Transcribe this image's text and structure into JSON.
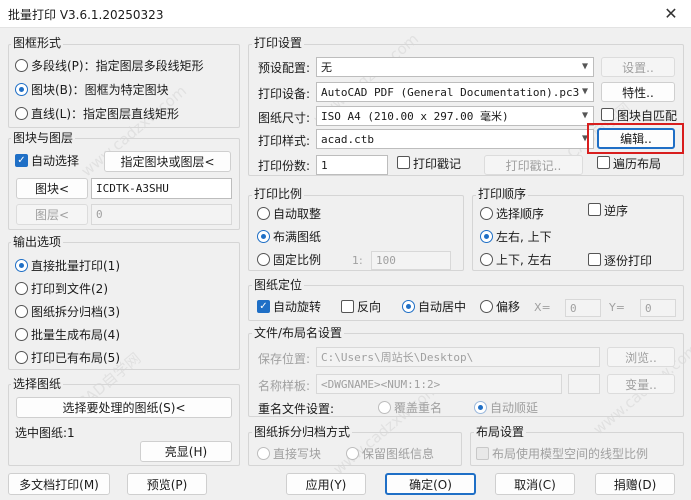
{
  "window": {
    "title": "批量打印 V3.6.1.20250323",
    "close_glyph": "✕"
  },
  "frame_style": {
    "label": "图框形式",
    "options": [
      {
        "label": "多段线(P)：指定图层多段线矩形",
        "selected": false
      },
      {
        "label": "图块(B)：图框为特定图块",
        "selected": true
      },
      {
        "label": "直线(L)：指定图层直线矩形",
        "selected": false
      }
    ]
  },
  "block_layer": {
    "label": "图块与图层",
    "auto_select_label": "自动选择",
    "auto_select_checked": true,
    "pick_button": "指定图块或图层<",
    "block_button": "图块<",
    "block_value": "ICDTK-A3SHU",
    "layer_button": "图层<",
    "layer_value": "0"
  },
  "output": {
    "label": "输出选项",
    "options": [
      {
        "label": "直接批量打印(1)",
        "selected": true
      },
      {
        "label": "打印到文件(2)",
        "selected": false
      },
      {
        "label": "图纸拆分归档(3)",
        "selected": false
      },
      {
        "label": "批量生成布局(4)",
        "selected": false
      },
      {
        "label": "打印已有布局(5)",
        "selected": false
      }
    ]
  },
  "select_drawing": {
    "label": "选择图纸",
    "select_button": "选择要处理的图纸(S)<",
    "selected_text": "选中图纸:1",
    "highlight_button": "亮显(H)"
  },
  "print_settings": {
    "label": "打印设置",
    "preset_label": "预设配置:",
    "preset_value": "无",
    "preset_settings_button": "设置..",
    "device_label": "打印设备:",
    "device_value": "AutoCAD PDF (General Documentation).pc3",
    "properties_button": "特性..",
    "paper_label": "图纸尺寸:",
    "paper_value": "ISO A4 (210.00 x 297.00 毫米)",
    "auto_match_label": "图块自匹配",
    "style_label": "打印样式:",
    "style_value": "acad.ctb",
    "edit_button": "编辑..",
    "copies_label": "打印份数:",
    "copies_value": "1",
    "stamp_label": "打印戳记",
    "stamp_button": "打印戳记..",
    "traverse_label": "遍历布局"
  },
  "print_scale": {
    "label": "打印比例",
    "options": [
      {
        "label": "自动取整",
        "selected": false
      },
      {
        "label": "布满图纸",
        "selected": true
      },
      {
        "label": "固定比例",
        "selected": false
      }
    ],
    "ratio_prefix": "1:",
    "ratio_value": "100"
  },
  "print_order": {
    "label": "打印顺序",
    "options": [
      {
        "label": "选择顺序",
        "selected": false
      },
      {
        "label": "左右, 上下",
        "selected": true
      },
      {
        "label": "上下, 左右",
        "selected": false
      }
    ],
    "reverse_label": "逆序",
    "round_trip_label": "逐份打印"
  },
  "positioning": {
    "label": "图纸定位",
    "auto_rotate_label": "自动旋转",
    "reverse_label": "反向",
    "auto_center_label": "自动居中",
    "offset_label": "偏移",
    "x_label": "X=",
    "x_value": "0",
    "y_label": "Y=",
    "y_value": "0"
  },
  "file_naming": {
    "label": "文件/布局名设置",
    "save_location_label": "保存位置:",
    "save_location_value": "C:\\Users\\周站长\\Desktop\\",
    "browse_button": "浏览..",
    "name_pattern_label": "名称样板:",
    "name_pattern_value": "<DWGNAME><NUM:1:2>",
    "variable_button": "变量..",
    "duplicate_label": "重名文件设置:",
    "overwrite_label": "覆盖重名",
    "auto_increment_label": "自动顺延"
  },
  "split_archive": {
    "label": "图纸拆分归档方式",
    "write_block_label": "直接写块",
    "keep_info_label": "保留图纸信息"
  },
  "layout_settings": {
    "label": "布局设置",
    "model_linetype_label": "布局使用模型空间的线型比例"
  },
  "footer": {
    "multi_doc_button": "多文档打印(M)",
    "preview_button": "预览(P)",
    "apply_button": "应用(Y)",
    "ok_button": "确定(O)",
    "cancel_button": "取消(C)",
    "donate_button": "捐赠(D)"
  },
  "watermark": {
    "text": "CAD自学网",
    "url_text": "www.cadzxw.com"
  },
  "colors": {
    "accent": "#1f6fc6",
    "highlight_box": "#d81e1e"
  }
}
